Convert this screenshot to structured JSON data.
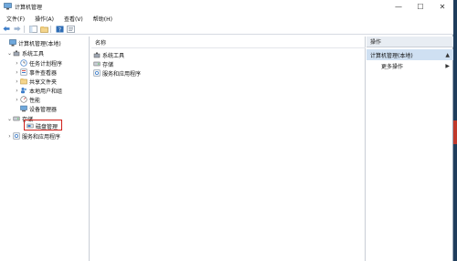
{
  "window": {
    "title": "计算机管理"
  },
  "title_controls": {
    "minimize": "—",
    "maximize": "☐",
    "close": "✕"
  },
  "menu": [
    "文件(F)",
    "操作(A)",
    "查看(V)",
    "帮助(H)"
  ],
  "tree": {
    "root": "计算机管理(本地)",
    "system_tools": "系统工具",
    "task_scheduler": "任务计划程序",
    "event_viewer": "事件查看器",
    "shared_folders": "共享文件夹",
    "local_users_groups": "本地用户和组",
    "performance": "性能",
    "device_manager": "设备管理器",
    "storage": "存储",
    "disk_management": "磁盘管理",
    "services_apps": "服务和应用程序"
  },
  "main": {
    "column_name": "名称",
    "items": [
      "系统工具",
      "存储",
      "服务和应用程序"
    ]
  },
  "actions": {
    "header": "操作",
    "section": "计算机管理(本地)",
    "more": "更多操作"
  },
  "colors": {
    "highlight_border": "#d0201a",
    "action_section_bg": "#cfe0f2"
  },
  "icons": [
    "computer-icon",
    "tools-icon",
    "clock-icon",
    "event-icon",
    "folder-share-icon",
    "users-icon",
    "performance-icon",
    "device-icon",
    "storage-icon",
    "disk-icon",
    "services-icon"
  ]
}
